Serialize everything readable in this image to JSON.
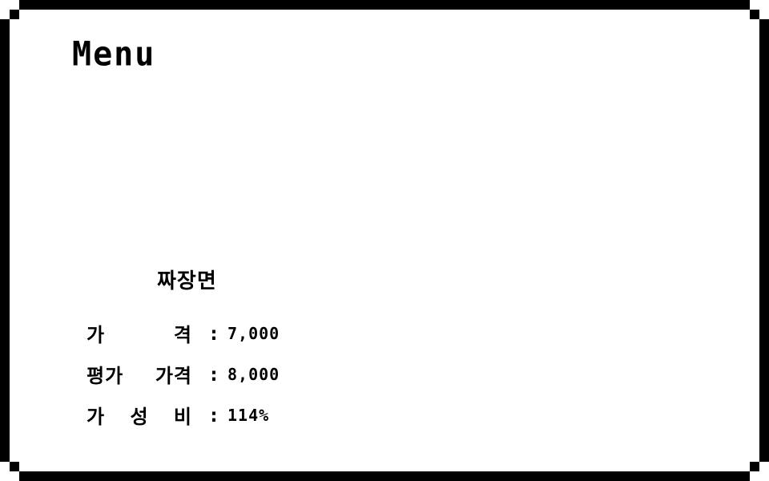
{
  "window": {
    "title": "Menu"
  },
  "item": {
    "name": "짜장면"
  },
  "stats": [
    {
      "label_parts": [
        "가",
        "격"
      ],
      "separator": ":",
      "value": "7,000"
    },
    {
      "label_parts": [
        "평가",
        "가격"
      ],
      "separator": ":",
      "value": "8,000"
    },
    {
      "label_parts": [
        "가",
        "성",
        "비"
      ],
      "separator": ":",
      "value": "114%"
    }
  ],
  "colors": {
    "background": "#ffffff",
    "border": "#000000",
    "text": "#000000"
  }
}
